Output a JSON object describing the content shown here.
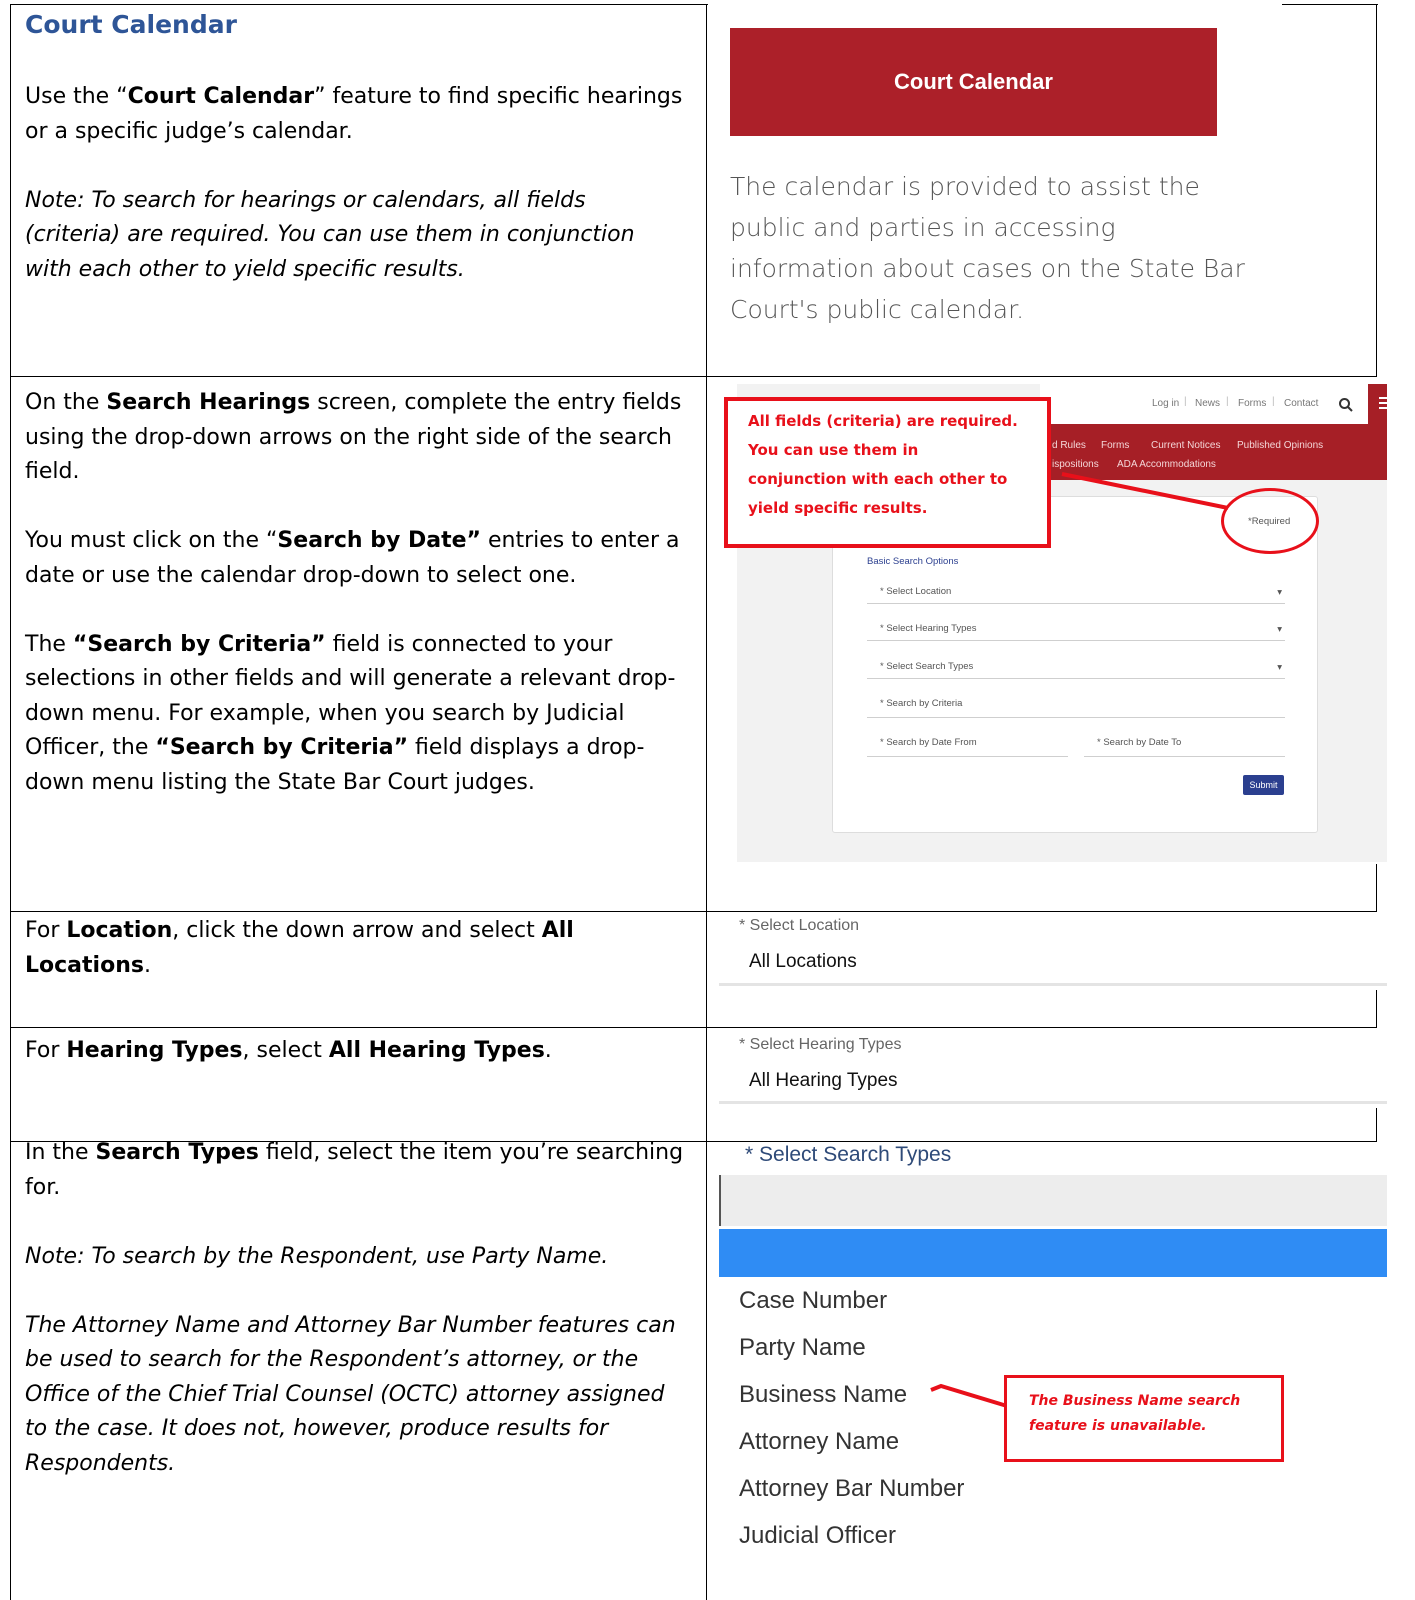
{
  "title": "Court Calendar",
  "row1": {
    "p1_pre": "Use the “",
    "p1_bold": "Court Calendar",
    "p1_post": "” feature to find specific hearings or a specific judge’s calendar.",
    "note": "Note: To search for hearings or calendars, all fields (criteria) are required. You can use them in conjunction with each other to yield specific results.",
    "banner": "Court Calendar",
    "description": "The calendar is provided to assist the public and parties in accessing information about cases on the State Bar Court's public calendar."
  },
  "row2": {
    "p1_pre": "On the ",
    "p1_bold": "Search Hearings",
    "p1_post": " screen, complete the entry fields using the drop-down arrows on the right side of the search field.",
    "p2_pre": "You must click on the “",
    "p2_bold": "Search by Date”",
    "p2_post": " entries to enter a date or use the calendar drop-down to select one.",
    "p3_pre": "The ",
    "p3_bold1": "“Search by Criteria”",
    "p3_mid": " field is connected to your selections in other fields and will generate a relevant drop-down menu. For example, when you search by Judicial Officer, the ",
    "p3_bold2": "“Search by Criteria”",
    "p3_post": " field displays a drop-down menu listing the State Bar Court judges.",
    "screenshot": {
      "topnav": [
        "Log in",
        "News",
        "Forms",
        "Contact"
      ],
      "rednav_row1": [
        "d Rules",
        "Forms",
        "Current Notices",
        "Published Opinions"
      ],
      "rednav_row2": [
        "ispositions",
        "ADA Accommodations"
      ],
      "required": "*Required",
      "section_title": "Basic Search Options",
      "fields": [
        "* Select Location",
        "* Select Hearing Types",
        "* Select Search Types",
        "* Search by Criteria"
      ],
      "date_from": "* Search by Date From",
      "date_to": "* Search by Date To",
      "submit": "Submit",
      "callout_lines": [
        "All fields (criteria) are required.",
        "You can use them in",
        "conjunction with each other to",
        "yield specific results."
      ]
    }
  },
  "row3": {
    "pre": "For ",
    "b1": "Location",
    "mid": ", click the down arrow and select ",
    "b2": "All Locations",
    "post": ".",
    "select_label": "* Select Location",
    "select_value": "All Locations"
  },
  "row4": {
    "pre": "For ",
    "b1": "Hearing Types",
    "mid": ", select ",
    "b2": "All Hearing Types",
    "post": ".",
    "select_label": "* Select Hearing Types",
    "select_value": "All Hearing Types"
  },
  "row5": {
    "p1_pre": "In the ",
    "p1_bold": "Search Types",
    "p1_post": " field, select the item you’re searching for.",
    "note1": "Note: To search by the Respondent, use Party Name.",
    "note2": "The Attorney Name and Attorney Bar Number features can be used to search for the Respondent’s attorney, or the Office of the Chief Trial Counsel (OCTC) attorney assigned to the case.  It does not, however, produce results for Respondents.",
    "select_label": "* Select Search Types",
    "options": [
      "Case Number",
      "Party Name",
      "Business Name",
      "Attorney Name",
      "Attorney Bar Number",
      "Judicial Officer"
    ],
    "callout_lines": [
      "The Business Name search",
      "feature is unavailable."
    ]
  }
}
